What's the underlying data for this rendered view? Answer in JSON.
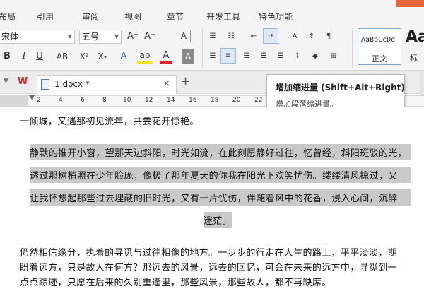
{
  "menu": {
    "tabs": [
      "布局",
      "引用",
      "审阅",
      "视图",
      "章节",
      "开发工具",
      "特色功能"
    ]
  },
  "ribbon": {
    "font_name": "宋体",
    "font_size": "五号",
    "grow_font": "A⁺",
    "shrink_font": "A⁻",
    "clear_format": "A",
    "bold": "B",
    "italic": "I",
    "underline": "U",
    "strike": "AB",
    "superscript": "X²",
    "subscript": "X₂",
    "text_effect": "A",
    "highlight": "ab",
    "font_color": "A",
    "char_shade": "A",
    "style_normal_sample": "AaBbCcDd",
    "style_normal_label": "正文",
    "style_next_sample": "Aa",
    "style_next_label": "标"
  },
  "doc_tab": {
    "logo": "W",
    "title": "1.docx *",
    "close": "×",
    "new_tab": "+"
  },
  "ruler": {
    "numbers": [
      "2",
      "4",
      "6",
      "8",
      "10",
      "12",
      "14",
      "16",
      "18",
      "20",
      "22",
      "24",
      "26",
      "28",
      "30",
      "32",
      "34"
    ]
  },
  "tooltip": {
    "title": "增加缩进量 (Shift+Alt+Right)",
    "description": "增加段落缩进量。"
  },
  "document": {
    "line_top": "一倾城，又遇那初见流年，共尝花开惊艳。",
    "highlight_lines": [
      "静默的推开小窗，望那天边斜阳，时光如流，在此刻愿静好过往，忆曾经，斜阳斑驳的光，",
      "透过那树梢照在少年脸庞，像极了那年夏天的你我在阳光下欢笑忧伤。缕缕清风掠过，又",
      "让我怀想起那些过去埋藏的旧时光，又有一片忧伤，伴随着风中的花香，浸入心间，沉醉",
      "迷茫。"
    ],
    "paragraph_lines": [
      "仍然相信缘分，执着的寻觅与过往相像的地方。一步步的行走在人生的路上，平平淡淡，期",
      "盼着远方，只是故人在何方？那远去的风景，远去的回忆，可会在未来的远方中，寻觅到一",
      "点点踪迹，只愿在后来的久别重逢里，那些风景，那些故人，都不再缺席。"
    ]
  },
  "colors": {
    "accent": "#e8663d",
    "wps_red": "#d8262e",
    "selection": "#c9c9c9"
  }
}
